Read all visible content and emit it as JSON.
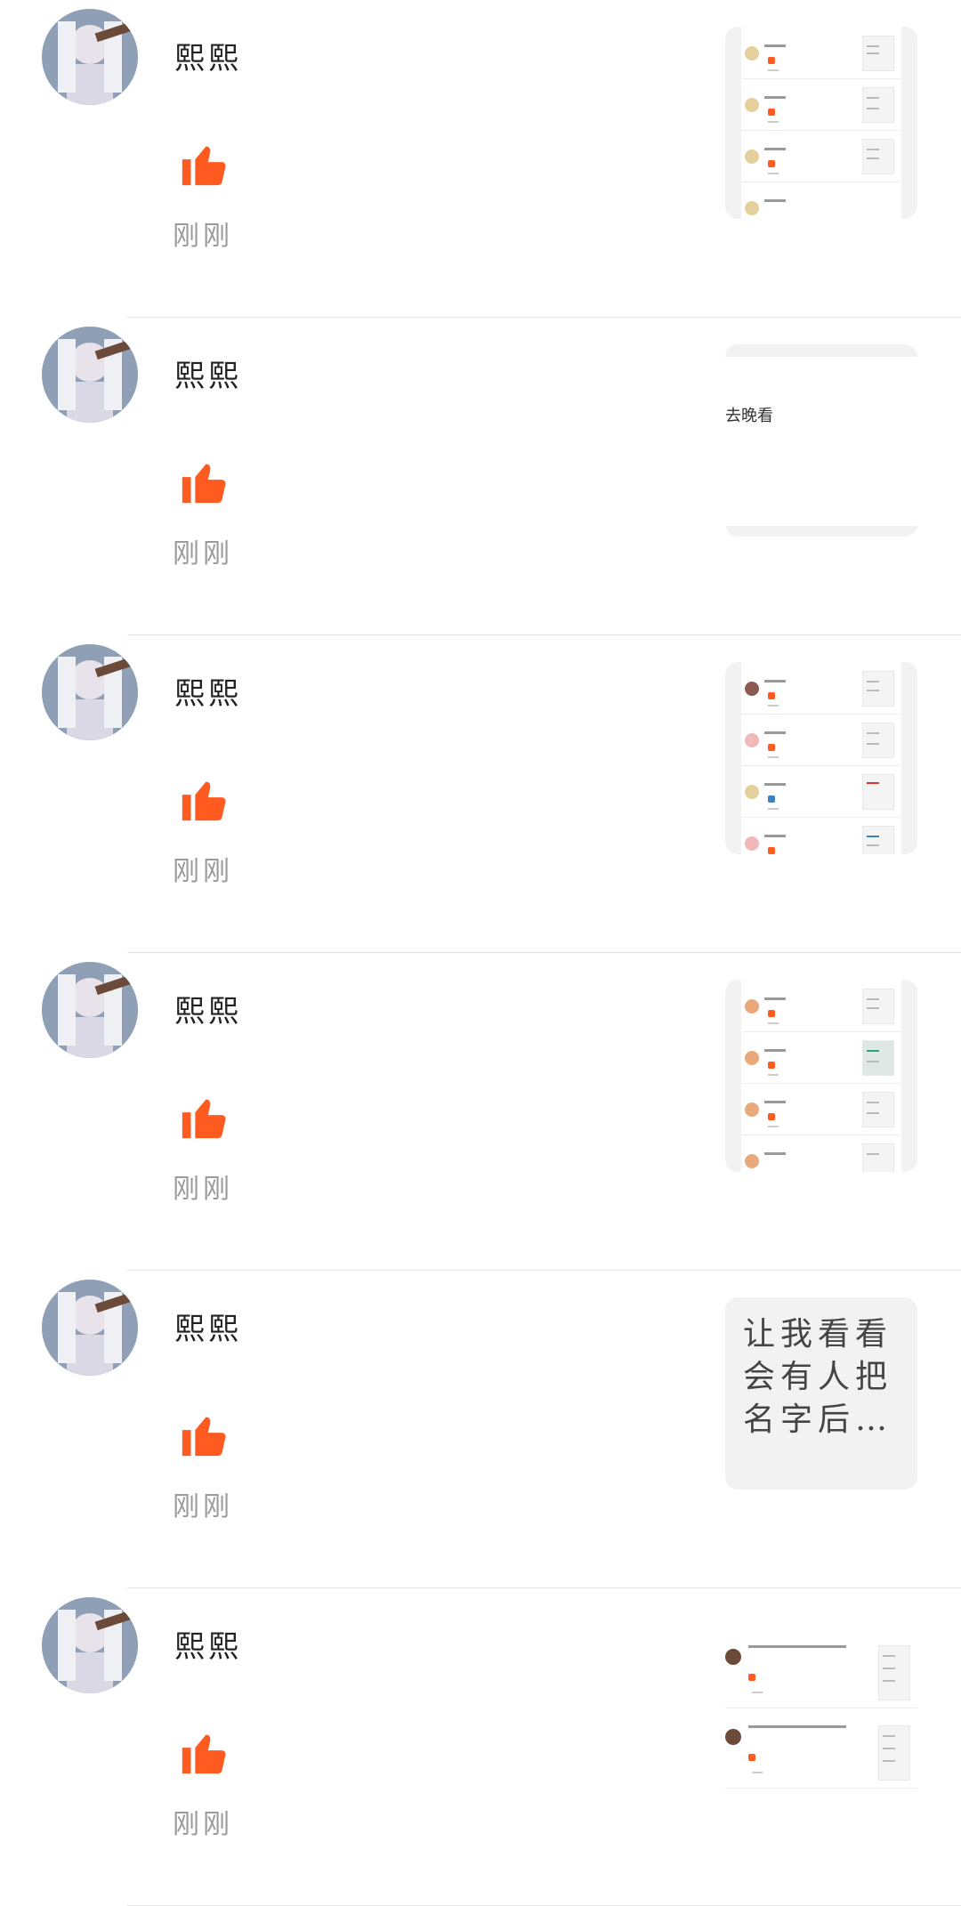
{
  "colors": {
    "accent": "#ff5a1f",
    "divider": "#e4e4e4",
    "time": "#9a9a9a"
  },
  "items": [
    {
      "name": "熙熙",
      "time": "刚刚",
      "thumb": {
        "kind": "screenshot"
      }
    },
    {
      "name": "熙熙",
      "time": "刚刚",
      "thumb": {
        "kind": "text-small",
        "text": "去晚看"
      }
    },
    {
      "name": "熙熙",
      "time": "刚刚",
      "thumb": {
        "kind": "screenshot"
      }
    },
    {
      "name": "熙熙",
      "time": "刚刚",
      "thumb": {
        "kind": "screenshot"
      }
    },
    {
      "name": "熙熙",
      "time": "刚刚",
      "thumb": {
        "kind": "text",
        "text": "让我看看会有人把名字后…"
      }
    },
    {
      "name": "熙熙",
      "time": "刚刚",
      "thumb": {
        "kind": "screenshot"
      }
    }
  ],
  "icons": {
    "avatar": "avatar-image",
    "like": "thumbs-up-icon"
  }
}
